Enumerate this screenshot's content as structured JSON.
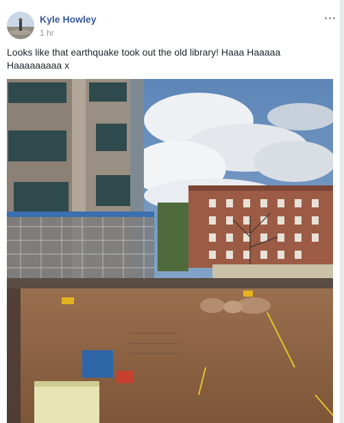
{
  "post": {
    "author": "Kyle Howley",
    "timestamp": "1 hr",
    "text": "Looks like that earthquake took out the old library! Haaa Haaaaa Haaaaaaaaa x",
    "menu_icon": "more-horizontal-icon",
    "colors": {
      "author_link": "#365899",
      "timestamp": "#90949c",
      "body_text": "#1d2129"
    }
  }
}
